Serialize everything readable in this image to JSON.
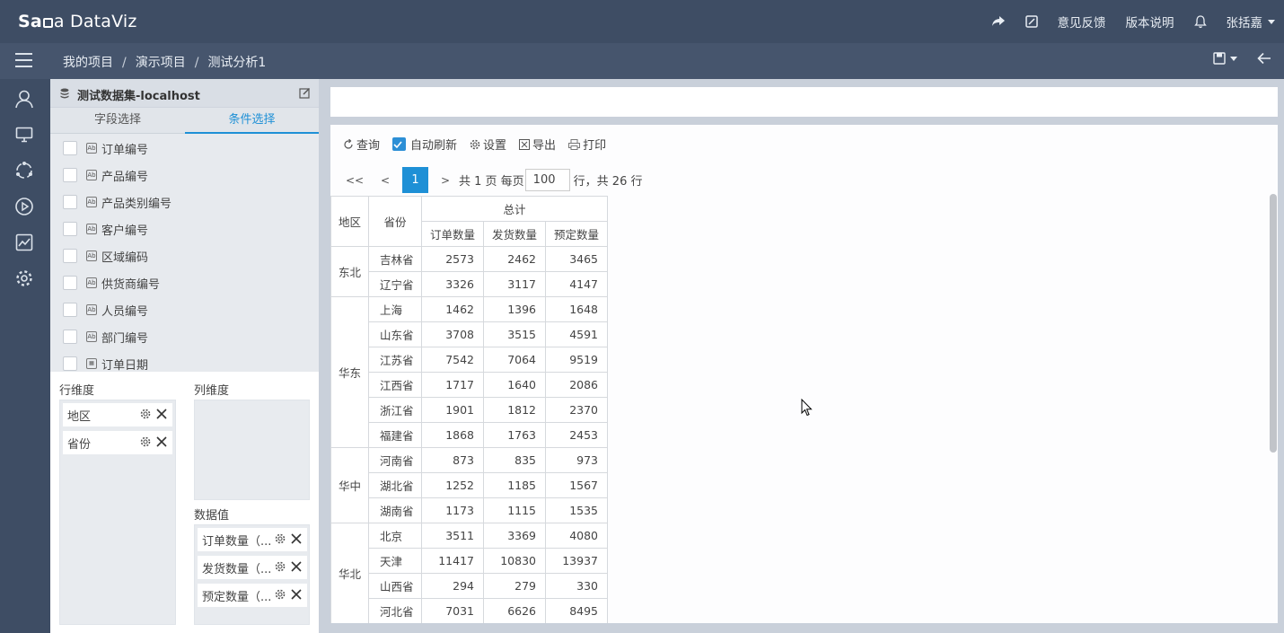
{
  "app": {
    "logo_a": "Sa",
    "logo_b": "a DataViz"
  },
  "topbar": {
    "feedback": "意见反馈",
    "version": "版本说明",
    "user": "张括嘉"
  },
  "breadcrumb": {
    "items": [
      "我的项目",
      "演示项目",
      "测试分析1"
    ],
    "separator": "/"
  },
  "dataset": {
    "title": "测试数据集-localhost"
  },
  "tabs": {
    "fields": "字段选择",
    "conditions": "条件选择"
  },
  "fields": [
    {
      "label": "订单编号",
      "icon": "Ab"
    },
    {
      "label": "产品编号",
      "icon": "Ab"
    },
    {
      "label": "产品类别编号",
      "icon": "Ab"
    },
    {
      "label": "客户编号",
      "icon": "Ab"
    },
    {
      "label": "区域编码",
      "icon": "Ab"
    },
    {
      "label": "供货商编号",
      "icon": "Ab"
    },
    {
      "label": "人员编号",
      "icon": "Ab"
    },
    {
      "label": "部门编号",
      "icon": "Ab"
    },
    {
      "label": "订单日期",
      "icon": "calendar"
    }
  ],
  "dims": {
    "row_label": "行维度",
    "col_label": "列维度",
    "value_label": "数据值",
    "rows": [
      "地区",
      "省份"
    ],
    "values": [
      "订单数量（...",
      "发货数量（...",
      "预定数量（..."
    ]
  },
  "toolbar": {
    "query": "查询",
    "auto_refresh": "自动刷新",
    "settings": "设置",
    "export": "导出",
    "print": "打印"
  },
  "pager": {
    "first": "<<",
    "prev": "<",
    "current": "1",
    "next": ">",
    "pages_text": "共 1 页 每页",
    "page_size": "100",
    "rows_text": "行，共 26 行"
  },
  "table": {
    "h_region": "地区",
    "h_province": "省份",
    "h_total": "总计",
    "h_cols": [
      "订单数量",
      "发货数量",
      "预定数量"
    ],
    "regions": [
      {
        "name": "东北",
        "rows": [
          {
            "prov": "吉林省",
            "v": [
              "2573",
              "2462",
              "3465"
            ]
          },
          {
            "prov": "辽宁省",
            "v": [
              "3326",
              "3117",
              "4147"
            ]
          }
        ]
      },
      {
        "name": "华东",
        "rows": [
          {
            "prov": "上海",
            "v": [
              "1462",
              "1396",
              "1648"
            ]
          },
          {
            "prov": "山东省",
            "v": [
              "3708",
              "3515",
              "4591"
            ]
          },
          {
            "prov": "江苏省",
            "v": [
              "7542",
              "7064",
              "9519"
            ]
          },
          {
            "prov": "江西省",
            "v": [
              "1717",
              "1640",
              "2086"
            ]
          },
          {
            "prov": "浙江省",
            "v": [
              "1901",
              "1812",
              "2370"
            ]
          },
          {
            "prov": "福建省",
            "v": [
              "1868",
              "1763",
              "2453"
            ]
          }
        ]
      },
      {
        "name": "华中",
        "rows": [
          {
            "prov": "河南省",
            "v": [
              "873",
              "835",
              "973"
            ]
          },
          {
            "prov": "湖北省",
            "v": [
              "1252",
              "1185",
              "1567"
            ]
          },
          {
            "prov": "湖南省",
            "v": [
              "1173",
              "1115",
              "1535"
            ]
          }
        ]
      },
      {
        "name": "华北",
        "rows": [
          {
            "prov": "北京",
            "v": [
              "3511",
              "3369",
              "4080"
            ]
          },
          {
            "prov": "天津",
            "v": [
              "11417",
              "10830",
              "13937"
            ]
          },
          {
            "prov": "山西省",
            "v": [
              "294",
              "279",
              "330"
            ]
          },
          {
            "prov": "河北省",
            "v": [
              "7031",
              "6626",
              "8495"
            ]
          }
        ]
      }
    ]
  },
  "colors": {
    "topbar": "#3e4d64",
    "accent": "#1e90d6",
    "panel": "#e7eaee"
  }
}
